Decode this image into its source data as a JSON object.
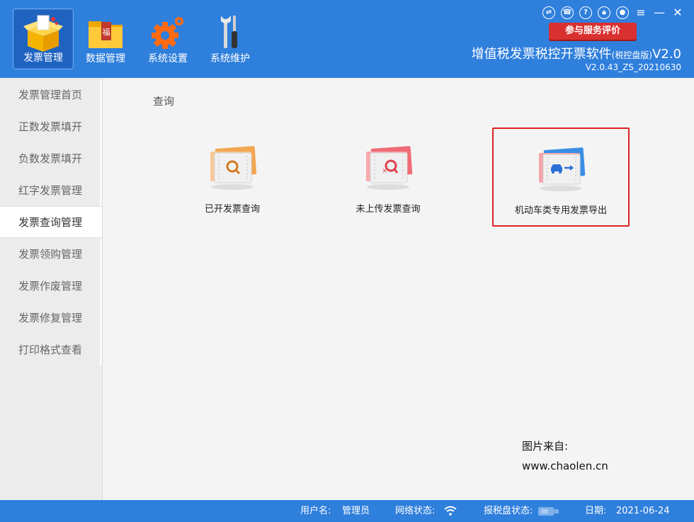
{
  "toolbar": {
    "items": [
      {
        "label": "发票管理",
        "icon": "invoice-box-icon",
        "active": true
      },
      {
        "label": "数据管理",
        "icon": "data-folder-icon",
        "active": false
      },
      {
        "label": "系统设置",
        "icon": "gear-icon",
        "active": false
      },
      {
        "label": "系统维护",
        "icon": "tools-icon",
        "active": false
      }
    ]
  },
  "window_controls": {
    "icons": [
      "swap-icon",
      "phone-icon",
      "help-icon",
      "lock-icon",
      "user-icon",
      "menu-icon",
      "minimize-icon",
      "close-icon"
    ]
  },
  "eval_button": {
    "label": "参与服务评价"
  },
  "app": {
    "title_main": "增值税发票税控开票软件",
    "title_small": "(税控盘版)",
    "title_suffix": "V2.0",
    "version": "V2.0.43_ZS_20210630"
  },
  "sidebar": {
    "items": [
      {
        "label": "发票管理首页",
        "active": false
      },
      {
        "label": "正数发票填开",
        "active": false
      },
      {
        "label": "负数发票填开",
        "active": false
      },
      {
        "label": "红字发票管理",
        "active": false
      },
      {
        "label": "发票查询管理",
        "active": true
      },
      {
        "label": "发票领购管理",
        "active": false
      },
      {
        "label": "发票作废管理",
        "active": false
      },
      {
        "label": "发票修复管理",
        "active": false
      },
      {
        "label": "打印格式查看",
        "active": false
      }
    ]
  },
  "main": {
    "section_title": "查询",
    "cards": [
      {
        "label": "已开发票查询",
        "icon": "invoice-search-icon"
      },
      {
        "label": "未上传发票查询",
        "icon": "invoice-unuploaded-search-icon"
      },
      {
        "label": "机动车类专用发票导出",
        "icon": "vehicle-invoice-export-icon",
        "highlighted": true
      }
    ],
    "source": {
      "line1": "图片来自:",
      "line2": "www.chaolen.cn"
    }
  },
  "status": {
    "user_label": "用户名:",
    "user_value": "管理员",
    "network_label": "网络状态:",
    "taxdisk_label": "报税盘状态:",
    "date_label": "日期:",
    "date_value": "2021-06-24"
  },
  "colors": {
    "brand_blue": "#2f7fdc",
    "active_blue": "#1f63c0",
    "eval_red": "#d93030",
    "highlight_red": "#e02020"
  }
}
